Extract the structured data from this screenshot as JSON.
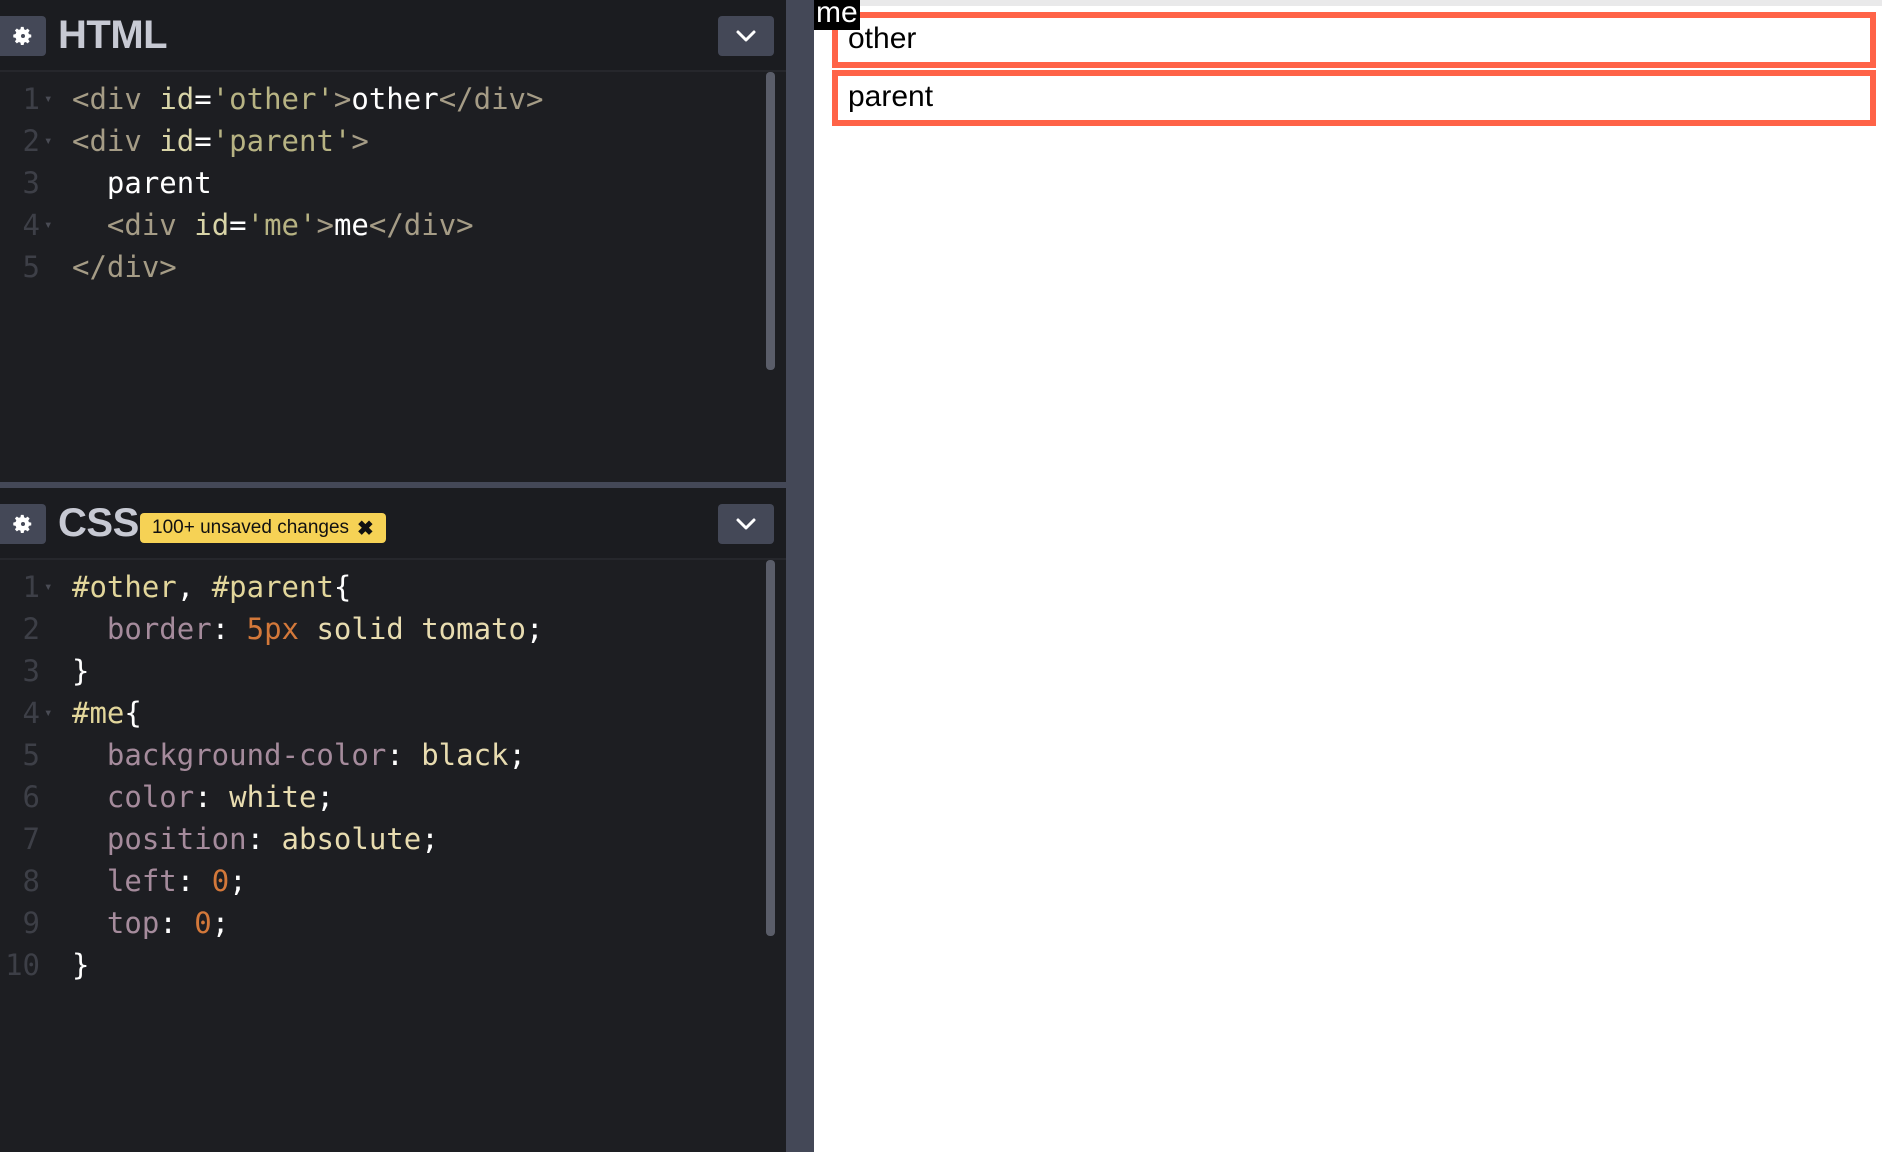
{
  "html_panel": {
    "title": "HTML",
    "lines": [
      {
        "n": "1",
        "fold": true,
        "tokens": [
          [
            "t-tag",
            "<div "
          ],
          [
            "t-attr",
            "id"
          ],
          [
            "t-punc",
            "="
          ],
          [
            "t-str",
            "'other'"
          ],
          [
            "t-tag",
            ">"
          ],
          [
            "t-text",
            "other"
          ],
          [
            "t-tag",
            "</div>"
          ]
        ]
      },
      {
        "n": "2",
        "fold": true,
        "tokens": [
          [
            "t-tag",
            "<div "
          ],
          [
            "t-attr",
            "id"
          ],
          [
            "t-punc",
            "="
          ],
          [
            "t-str",
            "'parent'"
          ],
          [
            "t-tag",
            ">"
          ]
        ]
      },
      {
        "n": "3",
        "fold": false,
        "tokens": [
          [
            "t-text",
            "  parent"
          ]
        ]
      },
      {
        "n": "4",
        "fold": true,
        "tokens": [
          [
            "t-text",
            "  "
          ],
          [
            "t-tag",
            "<div "
          ],
          [
            "t-attr",
            "id"
          ],
          [
            "t-punc",
            "="
          ],
          [
            "t-str",
            "'me'"
          ],
          [
            "t-tag",
            ">"
          ],
          [
            "t-text",
            "me"
          ],
          [
            "t-tag",
            "</div>"
          ]
        ]
      },
      {
        "n": "5",
        "fold": false,
        "tokens": [
          [
            "t-tag",
            "</div>"
          ]
        ]
      }
    ]
  },
  "css_panel": {
    "title": "CSS",
    "badge": "100+ unsaved changes",
    "lines": [
      {
        "n": "1",
        "fold": true,
        "tokens": [
          [
            "t-sel",
            "#other"
          ],
          [
            "t-punc",
            ", "
          ],
          [
            "t-sel",
            "#parent"
          ],
          [
            "t-punc",
            "{"
          ]
        ]
      },
      {
        "n": "2",
        "fold": false,
        "tokens": [
          [
            "t-text",
            "  "
          ],
          [
            "t-prop",
            "border"
          ],
          [
            "t-punc",
            ": "
          ],
          [
            "t-num",
            "5px"
          ],
          [
            "t-val",
            " solid tomato"
          ],
          [
            "t-punc",
            ";"
          ]
        ]
      },
      {
        "n": "3",
        "fold": false,
        "tokens": [
          [
            "t-punc",
            "}"
          ]
        ]
      },
      {
        "n": "4",
        "fold": true,
        "tokens": [
          [
            "t-sel",
            "#me"
          ],
          [
            "t-punc",
            "{"
          ]
        ]
      },
      {
        "n": "5",
        "fold": false,
        "tokens": [
          [
            "t-text",
            "  "
          ],
          [
            "t-prop",
            "background-color"
          ],
          [
            "t-punc",
            ": "
          ],
          [
            "t-val",
            "black"
          ],
          [
            "t-punc",
            ";"
          ]
        ]
      },
      {
        "n": "6",
        "fold": false,
        "tokens": [
          [
            "t-text",
            "  "
          ],
          [
            "t-prop",
            "color"
          ],
          [
            "t-punc",
            ": "
          ],
          [
            "t-val",
            "white"
          ],
          [
            "t-punc",
            ";"
          ]
        ]
      },
      {
        "n": "7",
        "fold": false,
        "tokens": [
          [
            "t-text",
            "  "
          ],
          [
            "t-prop",
            "position"
          ],
          [
            "t-punc",
            ": "
          ],
          [
            "t-val",
            "absolute"
          ],
          [
            "t-punc",
            ";"
          ]
        ]
      },
      {
        "n": "8",
        "fold": false,
        "tokens": [
          [
            "t-text",
            "  "
          ],
          [
            "t-prop",
            "left"
          ],
          [
            "t-punc",
            ": "
          ],
          [
            "t-num",
            "0"
          ],
          [
            "t-punc",
            ";"
          ]
        ]
      },
      {
        "n": "9",
        "fold": false,
        "tokens": [
          [
            "t-text",
            "  "
          ],
          [
            "t-prop",
            "top"
          ],
          [
            "t-punc",
            ": "
          ],
          [
            "t-num",
            "0"
          ],
          [
            "t-punc",
            ";"
          ]
        ]
      },
      {
        "n": "10",
        "fold": false,
        "tokens": [
          [
            "t-punc",
            "}"
          ]
        ]
      }
    ]
  },
  "preview": {
    "me": "me",
    "other": "other",
    "parent": "parent",
    "border_color": "#ff6347"
  },
  "icons": {
    "settings": "gear-icon",
    "collapse": "chevron-down-icon",
    "close_badge": "close-icon"
  }
}
